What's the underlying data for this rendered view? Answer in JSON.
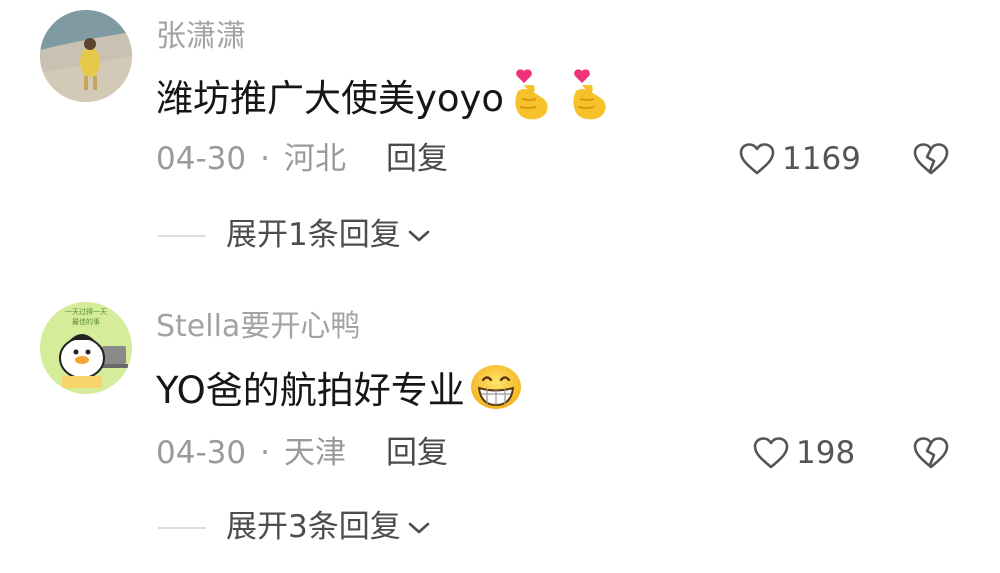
{
  "comments": [
    {
      "username": "张潇潇",
      "text": "潍坊推广大使美yoyo",
      "emojis": [
        "finger-heart-emoji",
        "finger-heart-emoji"
      ],
      "date": "04-30",
      "separator": "·",
      "location": "河北",
      "reply_label": "回复",
      "likes": "1169",
      "expand_label": "展开1条回复"
    },
    {
      "username": "Stella要开心鸭",
      "text": "YO爸的航拍好专业",
      "emojis": [
        "grinning-emoji"
      ],
      "date": "04-30",
      "separator": "·",
      "location": "天津",
      "reply_label": "回复",
      "likes": "198",
      "expand_label": "展开3条回复"
    }
  ],
  "colors": {
    "username": "#a3a3a3",
    "text": "#161616",
    "meta": "#9a9a9a",
    "reply": "#4a4a4a",
    "icon": "#555555"
  },
  "icons": [
    "heart-outline-icon",
    "broken-heart-icon",
    "chevron-down-icon"
  ]
}
